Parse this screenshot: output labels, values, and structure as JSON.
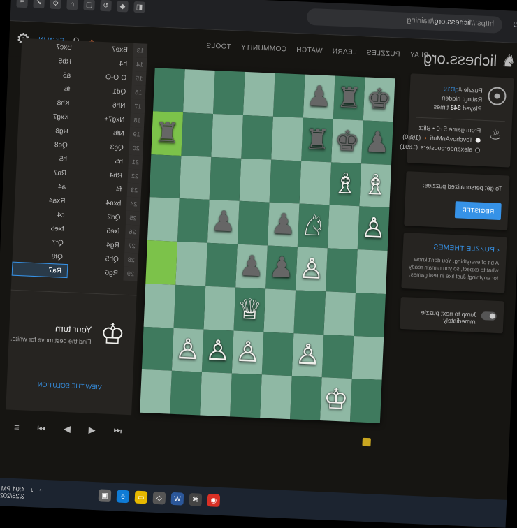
{
  "browser": {
    "url_protocol": "https://",
    "url_host": "lichess.org",
    "url_path": "/training",
    "nav_icons": [
      "back-icon",
      "forward-icon",
      "reload-icon"
    ],
    "extension_icons": [
      "extension-icon-1",
      "extension-icon-2",
      "extension-icon-3",
      "extension-icon-4",
      "extension-icon-5",
      "extension-icon-6",
      "extension-icon-7",
      "extension-icon-8"
    ]
  },
  "site": {
    "logo_text": "lichess.org",
    "menu": [
      "PLAY",
      "PUZZLES",
      "LEARN",
      "WATCH",
      "COMMUNITY",
      "TOOLS"
    ],
    "sign_in": "SIGN IN"
  },
  "puzzle": {
    "id_label": "Puzzle #",
    "id": "qD19",
    "rating_label": "Rating:",
    "rating_value": "hidden",
    "played_prefix": "Played",
    "played_count": "343",
    "played_suffix": "times",
    "game_line": "From game 5+0 • Blitz",
    "white_player": "TovchovAnMuti",
    "white_rating": "(1680)",
    "black_player": "alexanderpoosters",
    "black_rating": "(1691)"
  },
  "register": {
    "text": "To get personalized puzzles:",
    "button": "REGISTER"
  },
  "themes": {
    "title": "PUZZLE THEMES",
    "description": "A bit of everything. You don't know what to expect, so you remain ready for anything! Just like in real games."
  },
  "jump": {
    "label": "Jump to next puzzle immediately"
  },
  "board": {
    "pieces": [
      "b6",
      "b5",
      "b7",
      "",
      "",
      "",
      "",
      "",
      "b7",
      "b6",
      "b5",
      "",
      "",
      "",
      "",
      "b5",
      "w5",
      "w5",
      "",
      "",
      "",
      "",
      "",
      "",
      "w7",
      "",
      "w4",
      "b7",
      "",
      "b7",
      "",
      "",
      "",
      "",
      "w7",
      "b7",
      "b7",
      "",
      "",
      "",
      "",
      "",
      "",
      "",
      "w3",
      "",
      "",
      "",
      "",
      "",
      "w7",
      "",
      "w7",
      "w7",
      "w7",
      "",
      "",
      "w6",
      "",
      "",
      "",
      "",
      "",
      ""
    ],
    "highlights": [
      15,
      39
    ]
  },
  "piece_glyphs": {
    "w1": "♔",
    "w2": "♕",
    "w3": "♕",
    "w4": "♘",
    "w5": "♗",
    "w6": "♔",
    "w7": "♙",
    "b1": "♚",
    "b5": "♜",
    "b6": "♚",
    "b7": "♟"
  },
  "moves": [
    {
      "n": "13",
      "w": "Bxe7",
      "b": "Bxe7"
    },
    {
      "n": "14",
      "w": "h4",
      "b": "Rb5"
    },
    {
      "n": "15",
      "w": "O-O-O",
      "b": "a5"
    },
    {
      "n": "16",
      "w": "Qd1",
      "b": "f6"
    },
    {
      "n": "17",
      "w": "Nh6",
      "b": "Kh8"
    },
    {
      "n": "18",
      "w": "Nxg7+",
      "b": "Kxg7"
    },
    {
      "n": "19",
      "w": "Nf6",
      "b": "Rg8"
    },
    {
      "n": "20",
      "w": "Qg3",
      "b": "Qe8"
    },
    {
      "n": "21",
      "w": "h5",
      "b": "b5"
    },
    {
      "n": "22",
      "w": "Rh4",
      "b": "Ra7"
    },
    {
      "n": "23",
      "w": "f4",
      "b": "a4"
    },
    {
      "n": "24",
      "w": "bxa4",
      "b": "Rxa4"
    },
    {
      "n": "25",
      "w": "Qd2",
      "b": "c4"
    },
    {
      "n": "26",
      "w": "fxe5",
      "b": "fxe5"
    },
    {
      "n": "27",
      "w": "Rg4",
      "b": "Qf7"
    },
    {
      "n": "28",
      "w": "Qh5",
      "b": "Qf8"
    },
    {
      "n": "29",
      "w": "Rg6",
      "b": "Ra7"
    }
  ],
  "active_move_index": 16,
  "turn": {
    "title": "Your turn",
    "subtitle": "Find the best move for white.",
    "solution": "VIEW THE SOLUTION"
  },
  "taskbar": {
    "apps": [
      "chrome-icon",
      "app-icon-2",
      "word-icon",
      "app-icon-4",
      "folder-icon",
      "edge-icon",
      "app-icon-7"
    ],
    "time": "4:04 PM",
    "date": "3/25/2024"
  }
}
